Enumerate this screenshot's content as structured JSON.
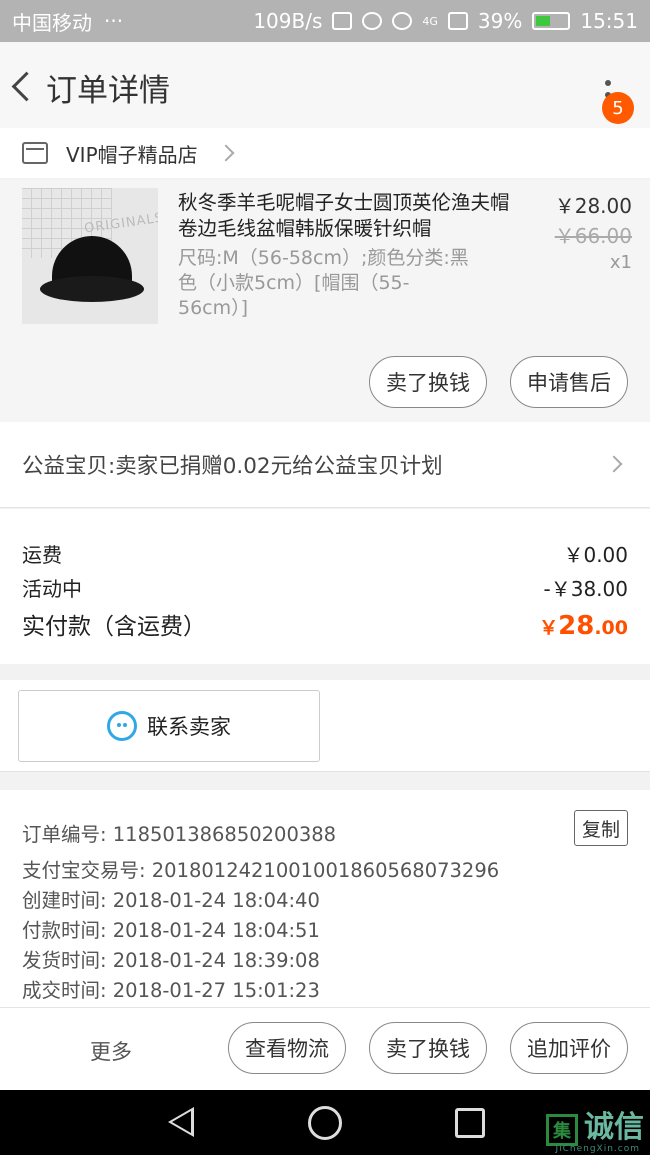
{
  "status_bar": {
    "carrier": "中国移动",
    "carrier_more": "···",
    "net_speed": "109B/s",
    "signal_label": "4G",
    "battery_percent": "39%",
    "time": "15:51"
  },
  "header": {
    "title": "订单详情",
    "badge_count": "5"
  },
  "shop": {
    "name": "VIP帽子精品店"
  },
  "product": {
    "title": "秋冬季羊毛呢帽子女士圆顶英伦渔夫帽卷边毛线盆帽韩版保暖针织帽",
    "sku": "尺码:M（56-58cm）;颜色分类:黑色（小款5cm）[帽围（55-56cm）]",
    "price": "￥28.00",
    "original_price": "￥66.00",
    "quantity": "x1",
    "image_text": "ORIGINALS",
    "buttons": {
      "sell": "卖了换钱",
      "after_sale": "申请售后"
    }
  },
  "charity": {
    "text": "公益宝贝:卖家已捐赠0.02元给公益宝贝计划"
  },
  "fees": {
    "shipping_label": "运费",
    "shipping_value": "￥0.00",
    "promo_label": "活动中",
    "promo_value": "-￥38.00",
    "total_label": "实付款（含运费）",
    "total_symbol": "￥",
    "total_int": "28",
    "total_dec": ".00"
  },
  "contact": {
    "label": "联系卖家"
  },
  "order_info": {
    "copy_label": "复制",
    "rows": [
      "订单编号: 118501386850200388",
      "支付宝交易号: 2018012421001001860568073296",
      "创建时间: 2018-01-24 18:04:40",
      "付款时间: 2018-01-24 18:04:51",
      "发货时间: 2018-01-24 18:39:08",
      "成交时间: 2018-01-27 15:01:23"
    ]
  },
  "bottom_bar": {
    "more": "更多",
    "logistics": "查看物流",
    "sell": "卖了换钱",
    "review": "追加评价"
  },
  "watermark": {
    "box_char": "集",
    "text": "诚信",
    "sub": "JiChengXin.com"
  },
  "colors": {
    "accent": "#ff5000",
    "badge": "#ff5a00",
    "wangwang": "#2fa8e8"
  }
}
